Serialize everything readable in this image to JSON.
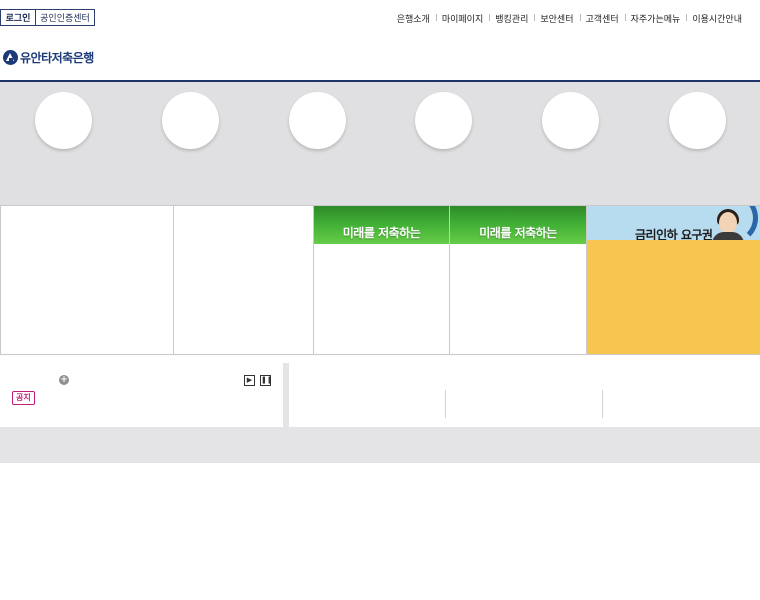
{
  "auth": {
    "login_label": "로그인",
    "cert_label": "공인인증센터"
  },
  "top_nav": [
    {
      "label": "은행소개"
    },
    {
      "label": "마이페이지"
    },
    {
      "label": "뱅킹관리"
    },
    {
      "label": "보안센터"
    },
    {
      "label": "고객센터"
    },
    {
      "label": "자주가는메뉴"
    },
    {
      "label": "이용시간안내"
    }
  ],
  "brand": {
    "name": "유안타저축은행",
    "logo_icon": "bank-logo-icon",
    "color": "#1d3a78"
  },
  "banners": {
    "future_saving_1": "미래를 저축하는",
    "future_saving_2": "미래를 저축하는",
    "rate_cut": "금리인하 요구권"
  },
  "notice": {
    "more_icon": "plus-circle-icon",
    "next_icon": "next-icon",
    "pause_icon": "pause-icon",
    "badge": "공지",
    "badge_color": "#c21d7a"
  },
  "colors": {
    "header_line": "#1f3468",
    "green_banner": "#3fae35",
    "rate_banner": "#f8c64f"
  }
}
